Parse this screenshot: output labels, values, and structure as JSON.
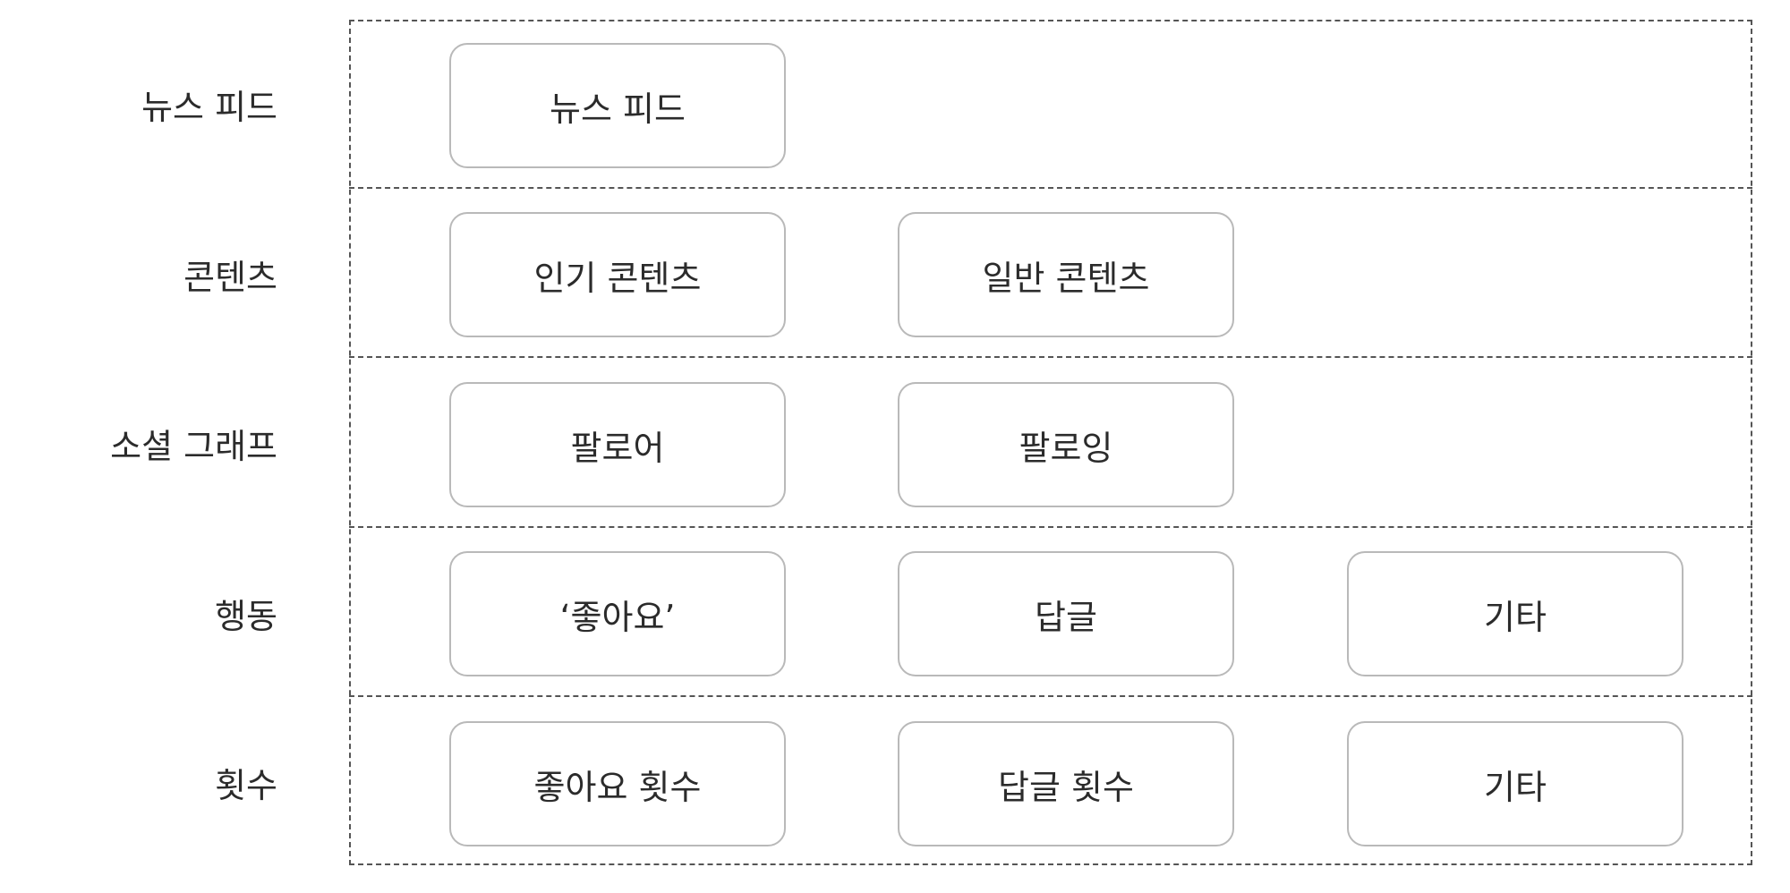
{
  "rows": [
    {
      "label": "뉴스 피드",
      "items": [
        "뉴스 피드"
      ]
    },
    {
      "label": "콘텐츠",
      "items": [
        "인기 콘텐츠",
        "일반 콘텐츠"
      ]
    },
    {
      "label": "소셜 그래프",
      "items": [
        "팔로어",
        "팔로잉"
      ]
    },
    {
      "label": "행동",
      "items": [
        "‘좋아요’",
        "답글",
        "기타"
      ]
    },
    {
      "label": "횟수",
      "items": [
        "좋아요 횟수",
        "답글 횟수",
        "기타"
      ]
    }
  ],
  "colors": {
    "text": "#2b2b2b",
    "node_border": "#b9b9b9",
    "dashed_line": "#555555",
    "background": "#ffffff"
  }
}
